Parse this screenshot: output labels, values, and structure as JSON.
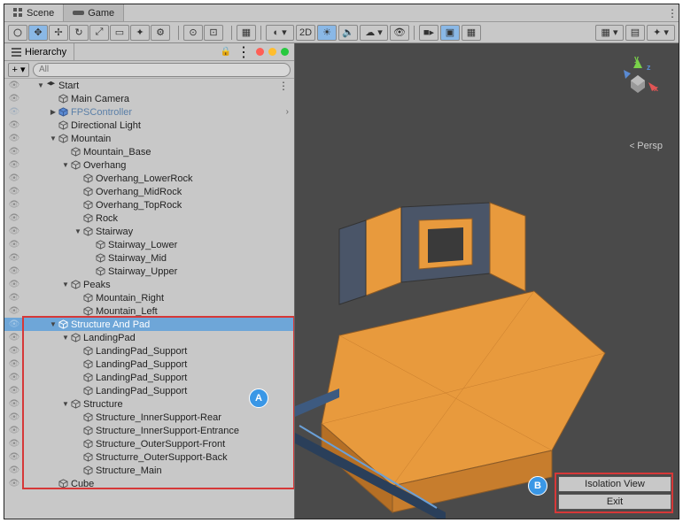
{
  "tabs": {
    "scene": "Scene",
    "game": "Game"
  },
  "hierarchy": {
    "title": "Hierarchy",
    "search_placeholder": "All",
    "rows": [
      {
        "indent": 0,
        "arrow": "down",
        "label": "Start",
        "sel": false,
        "prefab": false,
        "more": true
      },
      {
        "indent": 1,
        "arrow": "",
        "label": "Main Camera",
        "sel": false,
        "prefab": false
      },
      {
        "indent": 1,
        "arrow": "right",
        "label": "FPSController",
        "sel": false,
        "prefab": true,
        "chev": true
      },
      {
        "indent": 1,
        "arrow": "",
        "label": "Directional Light",
        "sel": false,
        "prefab": false
      },
      {
        "indent": 1,
        "arrow": "down",
        "label": "Mountain",
        "sel": false,
        "prefab": false
      },
      {
        "indent": 2,
        "arrow": "",
        "label": "Mountain_Base",
        "sel": false,
        "prefab": false
      },
      {
        "indent": 2,
        "arrow": "down",
        "label": "Overhang",
        "sel": false,
        "prefab": false
      },
      {
        "indent": 3,
        "arrow": "",
        "label": "Overhang_LowerRock",
        "sel": false,
        "prefab": false
      },
      {
        "indent": 3,
        "arrow": "",
        "label": "Overhang_MidRock",
        "sel": false,
        "prefab": false
      },
      {
        "indent": 3,
        "arrow": "",
        "label": "Overhang_TopRock",
        "sel": false,
        "prefab": false
      },
      {
        "indent": 3,
        "arrow": "",
        "label": "Rock",
        "sel": false,
        "prefab": false
      },
      {
        "indent": 3,
        "arrow": "down",
        "label": "Stairway",
        "sel": false,
        "prefab": false
      },
      {
        "indent": 4,
        "arrow": "",
        "label": "Stairway_Lower",
        "sel": false,
        "prefab": false
      },
      {
        "indent": 4,
        "arrow": "",
        "label": "Stairway_Mid",
        "sel": false,
        "prefab": false
      },
      {
        "indent": 4,
        "arrow": "",
        "label": "Stairway_Upper",
        "sel": false,
        "prefab": false
      },
      {
        "indent": 2,
        "arrow": "down",
        "label": "Peaks",
        "sel": false,
        "prefab": false
      },
      {
        "indent": 3,
        "arrow": "",
        "label": "Mountain_Right",
        "sel": false,
        "prefab": false
      },
      {
        "indent": 3,
        "arrow": "",
        "label": "Mountain_Left",
        "sel": false,
        "prefab": false
      },
      {
        "indent": 1,
        "arrow": "down",
        "label": "Structure And Pad",
        "sel": true,
        "prefab": false
      },
      {
        "indent": 2,
        "arrow": "down",
        "label": "LandingPad",
        "sel": false,
        "prefab": false
      },
      {
        "indent": 3,
        "arrow": "",
        "label": "LandingPad_Support",
        "sel": false,
        "prefab": false
      },
      {
        "indent": 3,
        "arrow": "",
        "label": "LandingPad_Support",
        "sel": false,
        "prefab": false
      },
      {
        "indent": 3,
        "arrow": "",
        "label": "LandingPad_Support",
        "sel": false,
        "prefab": false
      },
      {
        "indent": 3,
        "arrow": "",
        "label": "LandingPad_Support",
        "sel": false,
        "prefab": false
      },
      {
        "indent": 2,
        "arrow": "down",
        "label": "Structure",
        "sel": false,
        "prefab": false
      },
      {
        "indent": 3,
        "arrow": "",
        "label": "Structure_InnerSupport-Rear",
        "sel": false,
        "prefab": false
      },
      {
        "indent": 3,
        "arrow": "",
        "label": "Structure_InnerSupport-Entrance",
        "sel": false,
        "prefab": false
      },
      {
        "indent": 3,
        "arrow": "",
        "label": "Structure_OuterSupport-Front",
        "sel": false,
        "prefab": false
      },
      {
        "indent": 3,
        "arrow": "",
        "label": "Structurre_OuterSupport-Back",
        "sel": false,
        "prefab": false
      },
      {
        "indent": 3,
        "arrow": "",
        "label": "Structure_Main",
        "sel": false,
        "prefab": false
      },
      {
        "indent": 1,
        "arrow": "",
        "label": "Cube",
        "sel": false,
        "prefab": false
      }
    ]
  },
  "scene_view": {
    "camera_mode": "Persp",
    "axes": {
      "x": "x",
      "y": "y",
      "z": "z"
    }
  },
  "isolation": {
    "title": "Isolation View",
    "exit": "Exit"
  },
  "annotations": {
    "a": "A",
    "b": "B"
  },
  "toolbar": {
    "mode_2d": "2D"
  }
}
